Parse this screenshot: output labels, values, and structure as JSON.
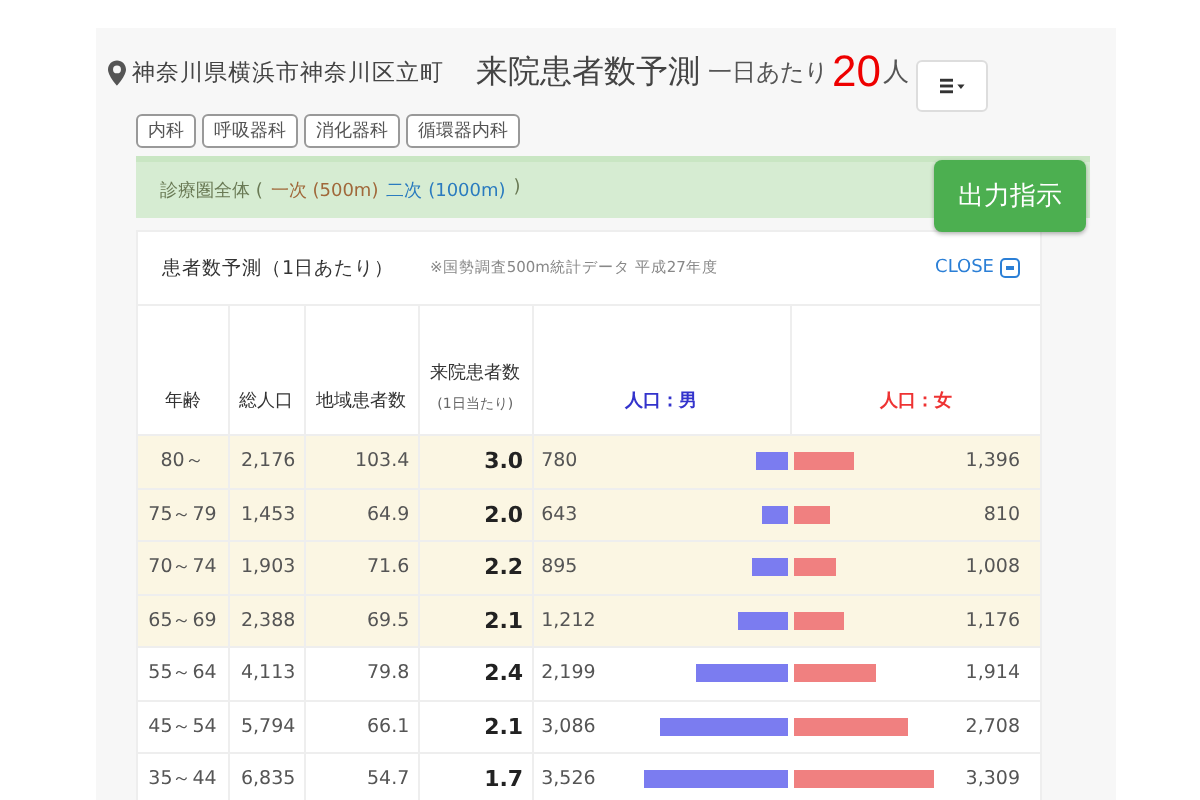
{
  "header": {
    "location": "神奈川県横浜市神奈川区立町",
    "title": "来院患者数予測",
    "per_day_label": "一日あたり",
    "per_day_value": "20",
    "unit": "人"
  },
  "departments": [
    {
      "label": "内科"
    },
    {
      "label": "呼吸器科"
    },
    {
      "label": "消化器科"
    },
    {
      "label": "循環器内科"
    }
  ],
  "area_bar": {
    "prefix": "診療圏全体 (",
    "options": [
      {
        "label": "一次 (500m)",
        "selected": true
      },
      {
        "label": "二次 (1000m)",
        "selected": false
      }
    ],
    "suffix": ")",
    "output_button": "出力指示"
  },
  "card": {
    "title": "患者数予測（1日あたり）",
    "note": "※国勢調査500m統計データ 平成27年度",
    "close_label": "CLOSE"
  },
  "table": {
    "columns": [
      {
        "label": "年齢"
      },
      {
        "label": "総人口"
      },
      {
        "label": "地域患者数"
      },
      {
        "label": "来院患者数",
        "sublabel": "(1日当たり)"
      },
      {
        "label": "人口：男"
      },
      {
        "label": "人口：女"
      }
    ],
    "rows": [
      {
        "age": "80～",
        "total": "2,176",
        "regional": "103.4",
        "visits": "3.0",
        "male": {
          "reading": "780",
          "level": 0.22
        },
        "female": {
          "reading": "1,396",
          "level": 0.39
        },
        "highlighted": true
      },
      {
        "age": "75～79",
        "total": "1,453",
        "regional": "64.9",
        "visits": "2.0",
        "male": {
          "reading": "643",
          "level": 0.18
        },
        "female": {
          "reading": "810",
          "level": 0.23
        },
        "highlighted": true
      },
      {
        "age": "70～74",
        "total": "1,903",
        "regional": "71.6",
        "visits": "2.2",
        "male": {
          "reading": "895",
          "level": 0.25
        },
        "female": {
          "reading": "1,008",
          "level": 0.28
        },
        "highlighted": true
      },
      {
        "age": "65～69",
        "total": "2,388",
        "regional": "69.5",
        "visits": "2.1",
        "male": {
          "reading": "1,212",
          "level": 0.34
        },
        "female": {
          "reading": "1,176",
          "level": 0.33
        },
        "highlighted": true
      },
      {
        "age": "55～64",
        "total": "4,113",
        "regional": "79.8",
        "visits": "2.4",
        "male": {
          "reading": "2,199",
          "level": 0.62
        },
        "female": {
          "reading": "1,914",
          "level": 0.54
        },
        "highlighted": false
      },
      {
        "age": "45～54",
        "total": "5,794",
        "regional": "66.1",
        "visits": "2.1",
        "male": {
          "reading": "3,086",
          "level": 0.86
        },
        "female": {
          "reading": "2,708",
          "level": 0.76
        },
        "highlighted": false
      },
      {
        "age": "35～44",
        "total": "6,835",
        "regional": "54.7",
        "visits": "1.7",
        "male": {
          "reading": "3,526",
          "level": 0.97
        },
        "female": {
          "reading": "3,309",
          "level": 0.93
        },
        "highlighted": false
      }
    ]
  }
}
